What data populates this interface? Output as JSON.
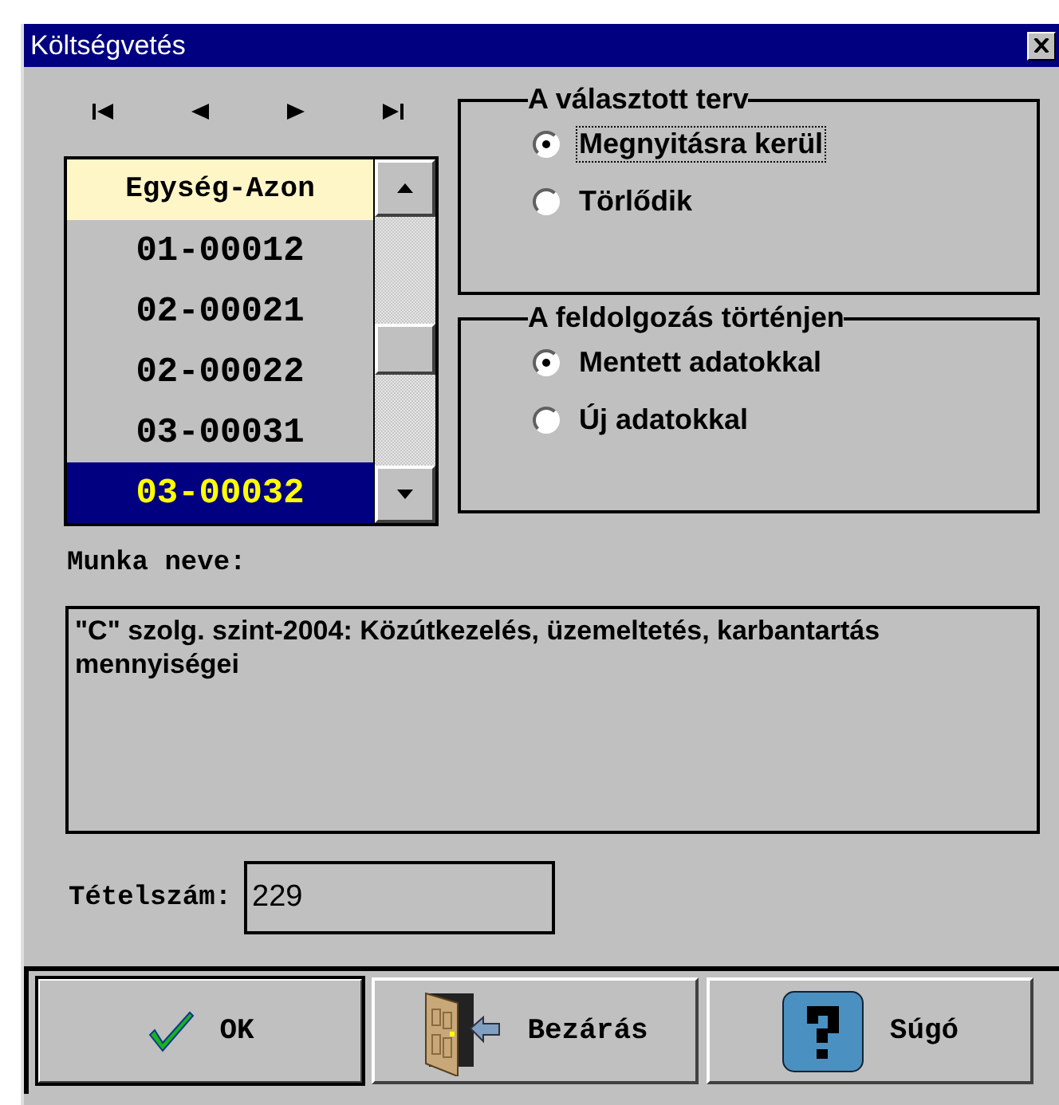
{
  "window": {
    "title": "Költségvetés"
  },
  "list": {
    "header": "Egység-Azon",
    "rows": [
      {
        "text": "01-00012",
        "selected": false
      },
      {
        "text": "02-00021",
        "selected": false
      },
      {
        "text": "02-00022",
        "selected": false
      },
      {
        "text": "03-00031",
        "selected": false
      },
      {
        "text": "03-00032",
        "selected": true
      }
    ]
  },
  "groups": [
    {
      "title": "A választott terv",
      "options": [
        {
          "label": "Megnyitásra kerül",
          "selected": true,
          "focused": true
        },
        {
          "label": "Törlődik",
          "selected": false,
          "focused": false
        }
      ]
    },
    {
      "title": "A feldolgozás történjen",
      "options": [
        {
          "label": "Mentett adatokkal",
          "selected": true,
          "focused": false
        },
        {
          "label": "Új adatokkal",
          "selected": false,
          "focused": false
        }
      ]
    }
  ],
  "work_name": {
    "label": "Munka neve:",
    "value": "\"C\" szolg. szint-2004: Közútkezelés, üzemeltetés, karbantartás mennyiségei"
  },
  "item_count": {
    "label": "Tételszám:",
    "value": "229"
  },
  "buttons": [
    {
      "kind": "ok",
      "label": "OK"
    },
    {
      "kind": "close",
      "label": "Bezárás"
    },
    {
      "kind": "help",
      "label": "Súgó"
    }
  ]
}
